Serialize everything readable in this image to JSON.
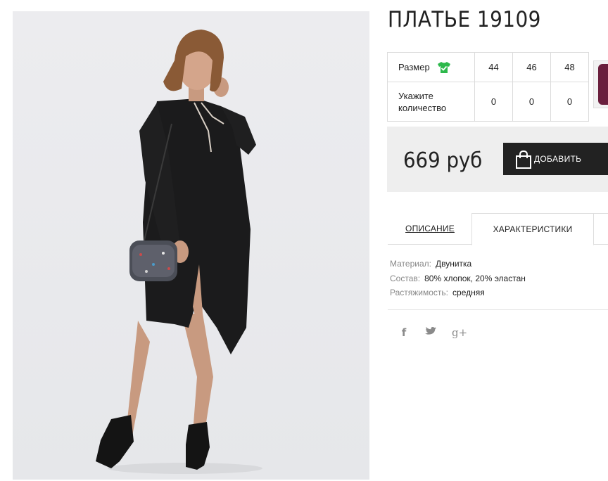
{
  "product": {
    "title": "ПЛАТЬЕ 19109",
    "image_alt": "dress-photo"
  },
  "size_table": {
    "size_label": "Размер",
    "size_icon": "shirt-check-icon",
    "size_icon_color": "#2db84b",
    "sizes": [
      "44",
      "46",
      "48"
    ],
    "qty_label_line1": "Укажите",
    "qty_label_line2": "количество",
    "quantities": [
      "0",
      "0",
      "0"
    ]
  },
  "purchase": {
    "price": "669 руб",
    "add_label": "ДОБАВИТЬ"
  },
  "tabs": {
    "description": "ОПИСАНИЕ",
    "characteristics": "ХАРАКТЕРИСТИКИ"
  },
  "specs": {
    "material_label": "Материал:",
    "material_value": "Двунитка",
    "composition_label": "Состав:",
    "composition_value": "80% хлопок, 20% эластан",
    "stretch_label": "Растяжимость:",
    "stretch_value": "средняя"
  },
  "social": {
    "facebook": "f",
    "twitter": "t",
    "google_plus": "g+"
  },
  "colors": {
    "button_bg": "#222222",
    "panel_bg": "#eeeeee",
    "accent_green": "#2db84b"
  }
}
